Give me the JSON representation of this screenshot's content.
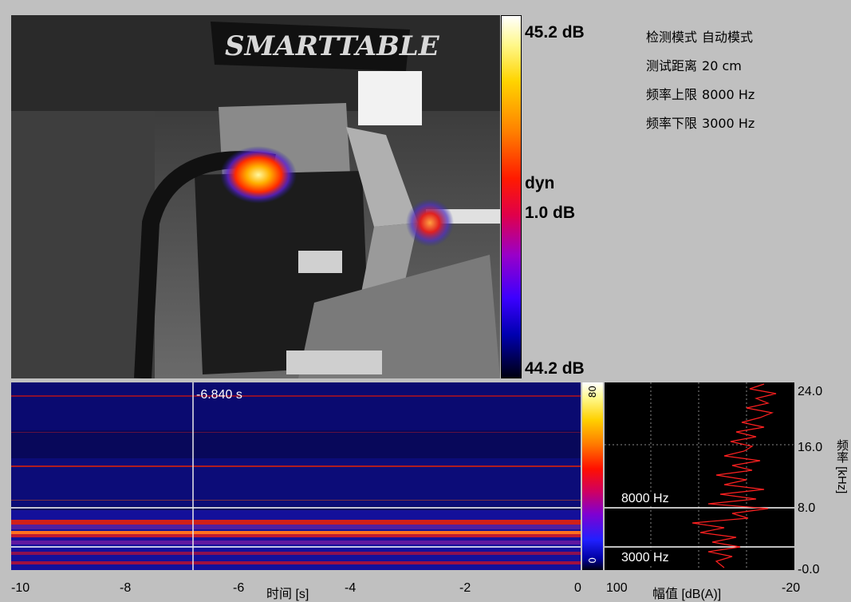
{
  "color_scale": {
    "max_label": "45.2 dB",
    "mode_label": "dyn",
    "range_label": "1.0 dB",
    "min_label": "44.2 dB"
  },
  "params": [
    {
      "label": "检测模式",
      "value": "自动模式"
    },
    {
      "label": "测试距离",
      "value": "20 cm"
    },
    {
      "label": "频率上限",
      "value": "8000 Hz"
    },
    {
      "label": "频率下限",
      "value": "3000 Hz"
    }
  ],
  "camera": {
    "brand_text": "SMARTTABLE"
  },
  "spectrogram": {
    "time_readout": "-6.840 s",
    "colorbar_max": "80",
    "colorbar_min": "0",
    "time_ticks": [
      "-10",
      "-8",
      "-6",
      "-4",
      "-2",
      "0"
    ],
    "time_axis_label": "时间 [s]",
    "upper_limit_label": "8000 Hz",
    "lower_limit_label": "3000 Hz"
  },
  "amplitude": {
    "ticks": [
      "100",
      "-20"
    ],
    "axis_label": "幅值 [dB(A)]"
  },
  "frequency_axis": {
    "ticks": [
      "24.0",
      "16.0",
      "8.0",
      "-0.0"
    ],
    "axis_label": "频率 [kHz]"
  }
}
